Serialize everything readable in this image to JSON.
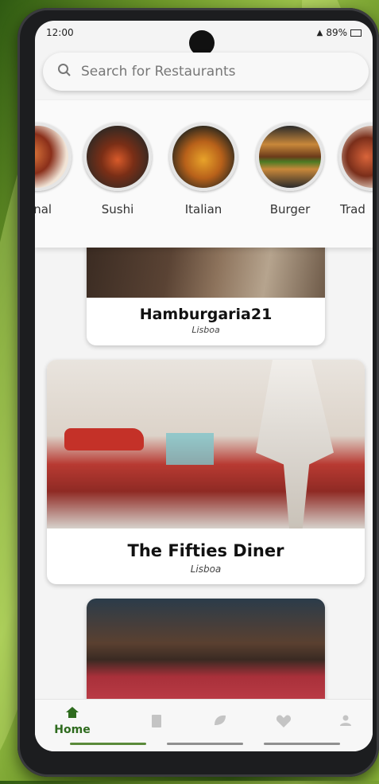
{
  "status_bar": {
    "time": "12:00",
    "right_indicators": "89%"
  },
  "search": {
    "placeholder": "Search for Restaurants"
  },
  "categories": [
    {
      "label": "ional"
    },
    {
      "label": "Sushi"
    },
    {
      "label": "Italian"
    },
    {
      "label": "Burger"
    },
    {
      "label": "Trad"
    }
  ],
  "restaurants": [
    {
      "name": "Hamburgaria21",
      "city": "Lisboa"
    },
    {
      "name": "The Fifties Diner",
      "city": "Lisboa"
    }
  ],
  "nav": {
    "home_label": "Home"
  },
  "colors": {
    "accent": "#2e6b1e",
    "screen_bg": "#f4f4f4"
  },
  "icons": [
    "search-icon",
    "home-icon",
    "bookmark-icon",
    "leaf-icon",
    "heart-icon",
    "profile-icon"
  ]
}
